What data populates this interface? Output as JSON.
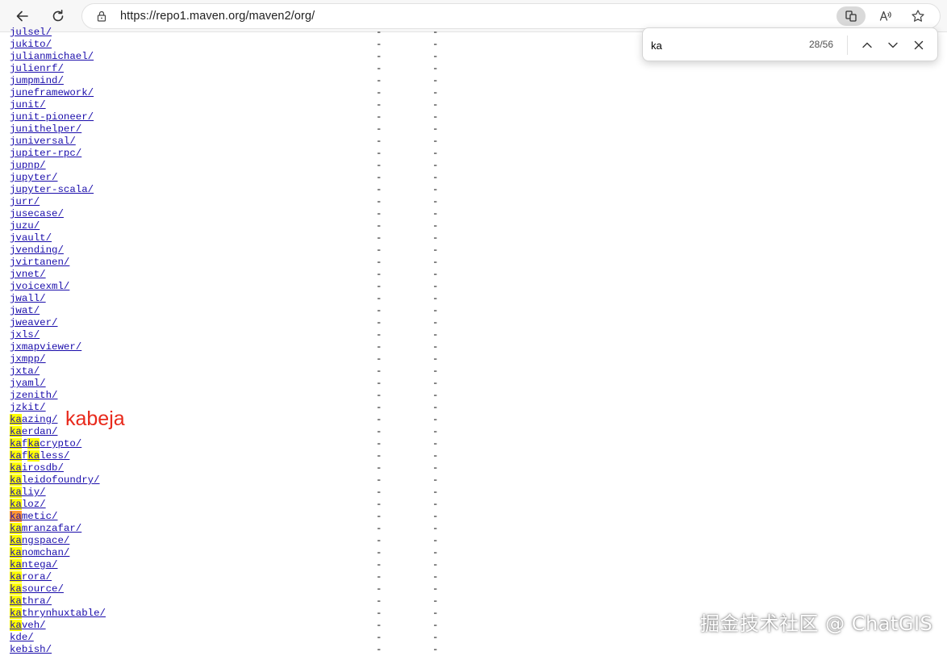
{
  "browser": {
    "url": "https://repo1.maven.org/maven2/org/",
    "back_icon": "arrow-left-icon",
    "refresh_icon": "refresh-icon",
    "lock_icon": "lock-icon",
    "app_icon": "app-available-icon",
    "read_aloud_icon": "read-aloud-icon",
    "favorite_icon": "star-icon"
  },
  "find_bar": {
    "query": "ka",
    "match_count": "28/56",
    "prev_icon": "chevron-up-icon",
    "next_icon": "chevron-down-icon",
    "close_icon": "close-icon",
    "highlight_color": "#ffff00",
    "current_highlight_color": "#ff9632"
  },
  "listing": {
    "link_color": "#1a0dab",
    "entries": [
      {
        "name": "julsel/",
        "date": "-",
        "size": "-"
      },
      {
        "name": "jukito/",
        "date": "-",
        "size": "-"
      },
      {
        "name": "julianmichael/",
        "date": "-",
        "size": "-"
      },
      {
        "name": "julienrf/",
        "date": "-",
        "size": "-"
      },
      {
        "name": "jumpmind/",
        "date": "-",
        "size": "-"
      },
      {
        "name": "juneframework/",
        "date": "-",
        "size": "-"
      },
      {
        "name": "junit/",
        "date": "-",
        "size": "-"
      },
      {
        "name": "junit-pioneer/",
        "date": "-",
        "size": "-"
      },
      {
        "name": "junithelper/",
        "date": "-",
        "size": "-"
      },
      {
        "name": "juniversal/",
        "date": "-",
        "size": "-"
      },
      {
        "name": "jupiter-rpc/",
        "date": "-",
        "size": "-"
      },
      {
        "name": "jupnp/",
        "date": "-",
        "size": "-"
      },
      {
        "name": "jupyter/",
        "date": "-",
        "size": "-"
      },
      {
        "name": "jupyter-scala/",
        "date": "-",
        "size": "-"
      },
      {
        "name": "jurr/",
        "date": "-",
        "size": "-"
      },
      {
        "name": "jusecase/",
        "date": "-",
        "size": "-"
      },
      {
        "name": "juzu/",
        "date": "-",
        "size": "-"
      },
      {
        "name": "jvault/",
        "date": "-",
        "size": "-"
      },
      {
        "name": "jvending/",
        "date": "-",
        "size": "-"
      },
      {
        "name": "jvirtanen/",
        "date": "-",
        "size": "-"
      },
      {
        "name": "jvnet/",
        "date": "-",
        "size": "-"
      },
      {
        "name": "jvoicexml/",
        "date": "-",
        "size": "-"
      },
      {
        "name": "jwall/",
        "date": "-",
        "size": "-"
      },
      {
        "name": "jwat/",
        "date": "-",
        "size": "-"
      },
      {
        "name": "jweaver/",
        "date": "-",
        "size": "-"
      },
      {
        "name": "jxls/",
        "date": "-",
        "size": "-"
      },
      {
        "name": "jxmapviewer/",
        "date": "-",
        "size": "-"
      },
      {
        "name": "jxmpp/",
        "date": "-",
        "size": "-"
      },
      {
        "name": "jxta/",
        "date": "-",
        "size": "-"
      },
      {
        "name": "jyaml/",
        "date": "-",
        "size": "-"
      },
      {
        "name": "jzenith/",
        "date": "-",
        "size": "-"
      },
      {
        "name": "jzkit/",
        "date": "-",
        "size": "-"
      },
      {
        "name": "kaazing/",
        "date": "-",
        "size": "-"
      },
      {
        "name": "kaerdan/",
        "date": "-",
        "size": "-"
      },
      {
        "name": "kafkacrypto/",
        "date": "-",
        "size": "-"
      },
      {
        "name": "kafkaless/",
        "date": "-",
        "size": "-"
      },
      {
        "name": "kairosdb/",
        "date": "-",
        "size": "-"
      },
      {
        "name": "kaleidofoundry/",
        "date": "-",
        "size": "-"
      },
      {
        "name": "kaliy/",
        "date": "-",
        "size": "-"
      },
      {
        "name": "kaloz/",
        "date": "-",
        "size": "-"
      },
      {
        "name": "kametic/",
        "date": "-",
        "size": "-",
        "current_match": true
      },
      {
        "name": "kamranzafar/",
        "date": "-",
        "size": "-"
      },
      {
        "name": "kangspace/",
        "date": "-",
        "size": "-"
      },
      {
        "name": "kanomchan/",
        "date": "-",
        "size": "-"
      },
      {
        "name": "kantega/",
        "date": "-",
        "size": "-"
      },
      {
        "name": "karora/",
        "date": "-",
        "size": "-"
      },
      {
        "name": "kasource/",
        "date": "-",
        "size": "-"
      },
      {
        "name": "kathra/",
        "date": "-",
        "size": "-"
      },
      {
        "name": "kathrynhuxtable/",
        "date": "-",
        "size": "-"
      },
      {
        "name": "kaveh/",
        "date": "-",
        "size": "-"
      },
      {
        "name": "kde/",
        "date": "-",
        "size": "-"
      },
      {
        "name": "kebish/",
        "date": "-",
        "size": "-"
      }
    ]
  },
  "annotation": {
    "text": "kabeja",
    "color": "#e8291b"
  },
  "watermark": {
    "text": "掘金技术社区 @ ChatGIS"
  }
}
